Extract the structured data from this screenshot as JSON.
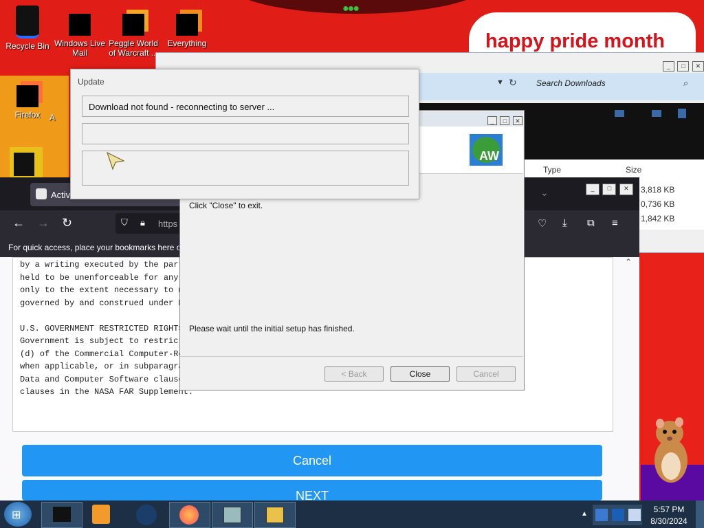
{
  "desktop": {
    "banner_text": "happy pride month",
    "icons": [
      {
        "label": "Recycle Bin",
        "icon": "recycle-bin-icon"
      },
      {
        "label": "Windows Live Mail",
        "icon": "mail-icon"
      },
      {
        "label": "Peggle World of Warcraft ...",
        "icon": "peggle-icon"
      },
      {
        "label": "Everything",
        "icon": "search-icon"
      },
      {
        "label": "Firefox",
        "icon": "firefox-icon"
      },
      {
        "label": "A",
        "icon": "app-icon"
      }
    ]
  },
  "explorer": {
    "search_placeholder": "Search Downloads",
    "col_type": "Type",
    "col_size": "Size",
    "sizes": [
      "3,818 KB",
      "0,736 KB",
      "1,842 KB"
    ]
  },
  "firefox": {
    "tab_title": "Activ",
    "url_prefix": "https",
    "bookmarks_hint": "For quick access, place your bookmarks here or",
    "license_lines": [
      "by a writing executed by the part",
      "held to be unenforceable for any",
      "only to the extent necessary to m",
      "governed by and construed under M",
      "",
      "U.S. GOVERNMENT RESTRICTED RIGHTS",
      "Government is subject to restrict",
      "(d) of the Commercial Computer-Re",
      "when applicable, or in subparagra",
      "Data and Computer Software clause",
      "clauses in the NASA FAR Supplement."
    ],
    "cancel_label": "Cancel",
    "next_label": "NEXT"
  },
  "setup": {
    "exit_text": "Click \"Close\" to exit.",
    "wait_text": "Please wait until the initial setup has finished.",
    "back_label": "< Back",
    "close_label": "Close",
    "cancel_label": "Cancel"
  },
  "update": {
    "title": "Update",
    "status": "Download not found - reconnecting to server ..."
  },
  "taskbar": {
    "time": "5:57 PM",
    "date": "8/30/2024"
  },
  "colors": {
    "desktop_red": "#e11d17",
    "firefox_button_blue": "#2196f3",
    "taskbar": "#1d2f44"
  }
}
